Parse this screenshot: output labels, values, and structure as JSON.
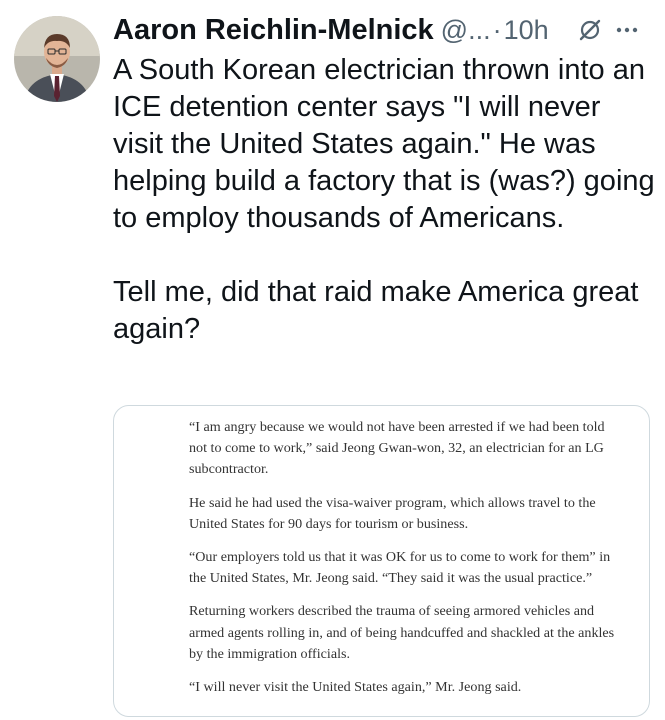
{
  "tweet": {
    "author_name": "Aaron Reichlin-Melnick",
    "handle": "@...",
    "separator": "·",
    "time": "10h",
    "paragraphs": [
      "A South Korean electrician thrown into an ICE detention center says \"I will never visit the United States again.\" He was helping build a factory that is (was?) going to employ thousands of Americans.",
      "Tell me, did that raid make America great again?"
    ]
  },
  "icons": {
    "grok": "grok-icon",
    "more": "more-options-icon"
  },
  "quoted_article": {
    "paragraphs": [
      "“I am angry because we would not have been arrested if we had been told not to come to work,” said Jeong Gwan-won, 32, an electrician for an LG subcontractor.",
      "He said he had used the visa-waiver program, which allows travel to the United States for 90 days for tourism or business.",
      "“Our employers told us that it was OK for us to come to work for them” in the United States, Mr. Jeong said. “They said it was the usual practice.”",
      "Returning workers described the trauma of seeing armored vehicles and armed agents rolling in, and of being handcuffed and shackled at the ankles by the immigration officials.",
      "“I will never visit the United States again,” Mr. Jeong said."
    ]
  }
}
